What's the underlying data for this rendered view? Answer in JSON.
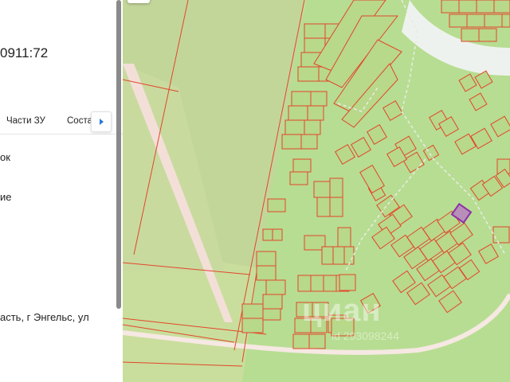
{
  "panel": {
    "cadastral_number": "0911:72",
    "tabs": [
      "Части ЗУ",
      "Соста"
    ],
    "fields": [
      "ок",
      "ие",
      "асть, г Энгельс, ул"
    ]
  },
  "map": {
    "watermark": "циан",
    "watermark_sub": "id 293098244"
  },
  "colors": {
    "map_background": "#c9de9c",
    "parcel_fill": "#b8d88a",
    "parcel_stroke": "#e2462a",
    "selected_parcel": "#8b2fa8",
    "road": "#f6e8e2",
    "river": "#eef2ee"
  }
}
